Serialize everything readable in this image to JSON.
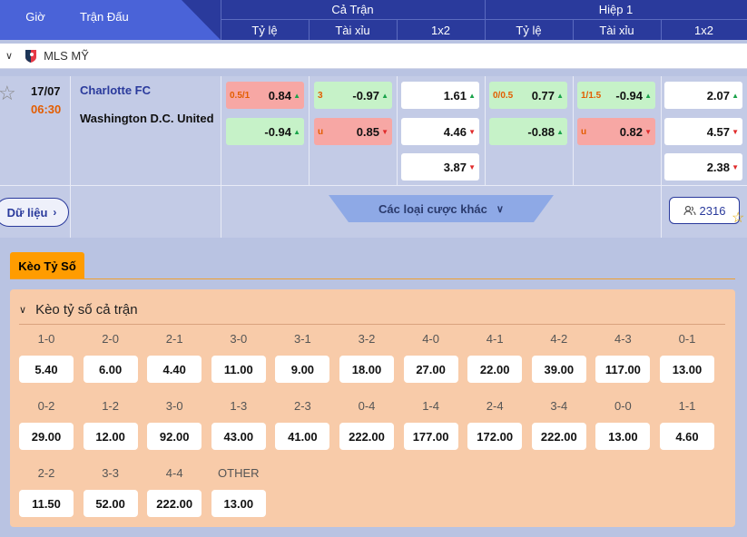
{
  "header": {
    "time": "Giờ",
    "match": "Trận Đấu",
    "full_match": "Cả Trận",
    "half1": "Hiệp 1",
    "handicap": "Tỷ lệ",
    "over_under": "Tài xỉu",
    "x12": "1x2"
  },
  "league": {
    "name": "MLS MỸ",
    "chevron": "chevron-down-icon",
    "logo": "mls-logo-icon"
  },
  "match": {
    "date": "17/07",
    "time": "06:30",
    "home": "Charlotte FC",
    "away": "Washington D.C. United",
    "ft_hdp": [
      {
        "line": "0.5/1",
        "value": "0.84",
        "dir": "up",
        "bg": "red"
      },
      {
        "line": "",
        "value": "-0.94",
        "dir": "up",
        "bg": "green"
      }
    ],
    "ft_ou": [
      {
        "line": "3",
        "value": "-0.97",
        "dir": "up",
        "bg": "green"
      },
      {
        "line": "u",
        "value": "0.85",
        "dir": "down",
        "bg": "red"
      }
    ],
    "ft_1x2": [
      {
        "value": "1.61",
        "dir": "up"
      },
      {
        "value": "4.46",
        "dir": "down"
      },
      {
        "value": "3.87",
        "dir": "down"
      }
    ],
    "h1_hdp": [
      {
        "line": "0/0.5",
        "value": "0.77",
        "dir": "up",
        "bg": "green"
      },
      {
        "line": "",
        "value": "-0.88",
        "dir": "up",
        "bg": "green"
      }
    ],
    "h1_ou": [
      {
        "line": "1/1.5",
        "value": "-0.94",
        "dir": "up",
        "bg": "green"
      },
      {
        "line": "u",
        "value": "0.82",
        "dir": "down",
        "bg": "red"
      }
    ],
    "h1_1x2": [
      {
        "value": "2.07",
        "dir": "up"
      },
      {
        "value": "4.57",
        "dir": "down"
      },
      {
        "value": "2.38",
        "dir": "down"
      }
    ],
    "data_button": "Dữ liệu",
    "more_bets": "Các loại cược khác",
    "viewers": "2316"
  },
  "colors": {
    "header_bg": "#2a3a9c",
    "accent": "#ff9c00",
    "up": "#1aa34a",
    "down": "#e02b2b"
  },
  "score_tab": "Kèo Tỷ Số",
  "score_section": "Kèo tỷ số cả trận",
  "scores": [
    {
      "label": "1-0",
      "odds": "5.40"
    },
    {
      "label": "2-0",
      "odds": "6.00"
    },
    {
      "label": "2-1",
      "odds": "4.40"
    },
    {
      "label": "3-0",
      "odds": "11.00"
    },
    {
      "label": "3-1",
      "odds": "9.00"
    },
    {
      "label": "3-2",
      "odds": "18.00"
    },
    {
      "label": "4-0",
      "odds": "27.00"
    },
    {
      "label": "4-1",
      "odds": "22.00"
    },
    {
      "label": "4-2",
      "odds": "39.00"
    },
    {
      "label": "4-3",
      "odds": "117.00"
    },
    {
      "label": "0-1",
      "odds": "13.00"
    },
    {
      "label": "0-2",
      "odds": "29.00"
    },
    {
      "label": "1-2",
      "odds": "12.00"
    },
    {
      "label": "3-0",
      "odds": "92.00"
    },
    {
      "label": "1-3",
      "odds": "43.00"
    },
    {
      "label": "2-3",
      "odds": "41.00"
    },
    {
      "label": "0-4",
      "odds": "222.00"
    },
    {
      "label": "1-4",
      "odds": "177.00"
    },
    {
      "label": "2-4",
      "odds": "172.00"
    },
    {
      "label": "3-4",
      "odds": "222.00"
    },
    {
      "label": "0-0",
      "odds": "13.00"
    },
    {
      "label": "1-1",
      "odds": "4.60"
    },
    {
      "label": "2-2",
      "odds": "11.50"
    },
    {
      "label": "3-3",
      "odds": "52.00"
    },
    {
      "label": "4-4",
      "odds": "222.00"
    },
    {
      "label": "OTHER",
      "odds": "13.00"
    }
  ]
}
